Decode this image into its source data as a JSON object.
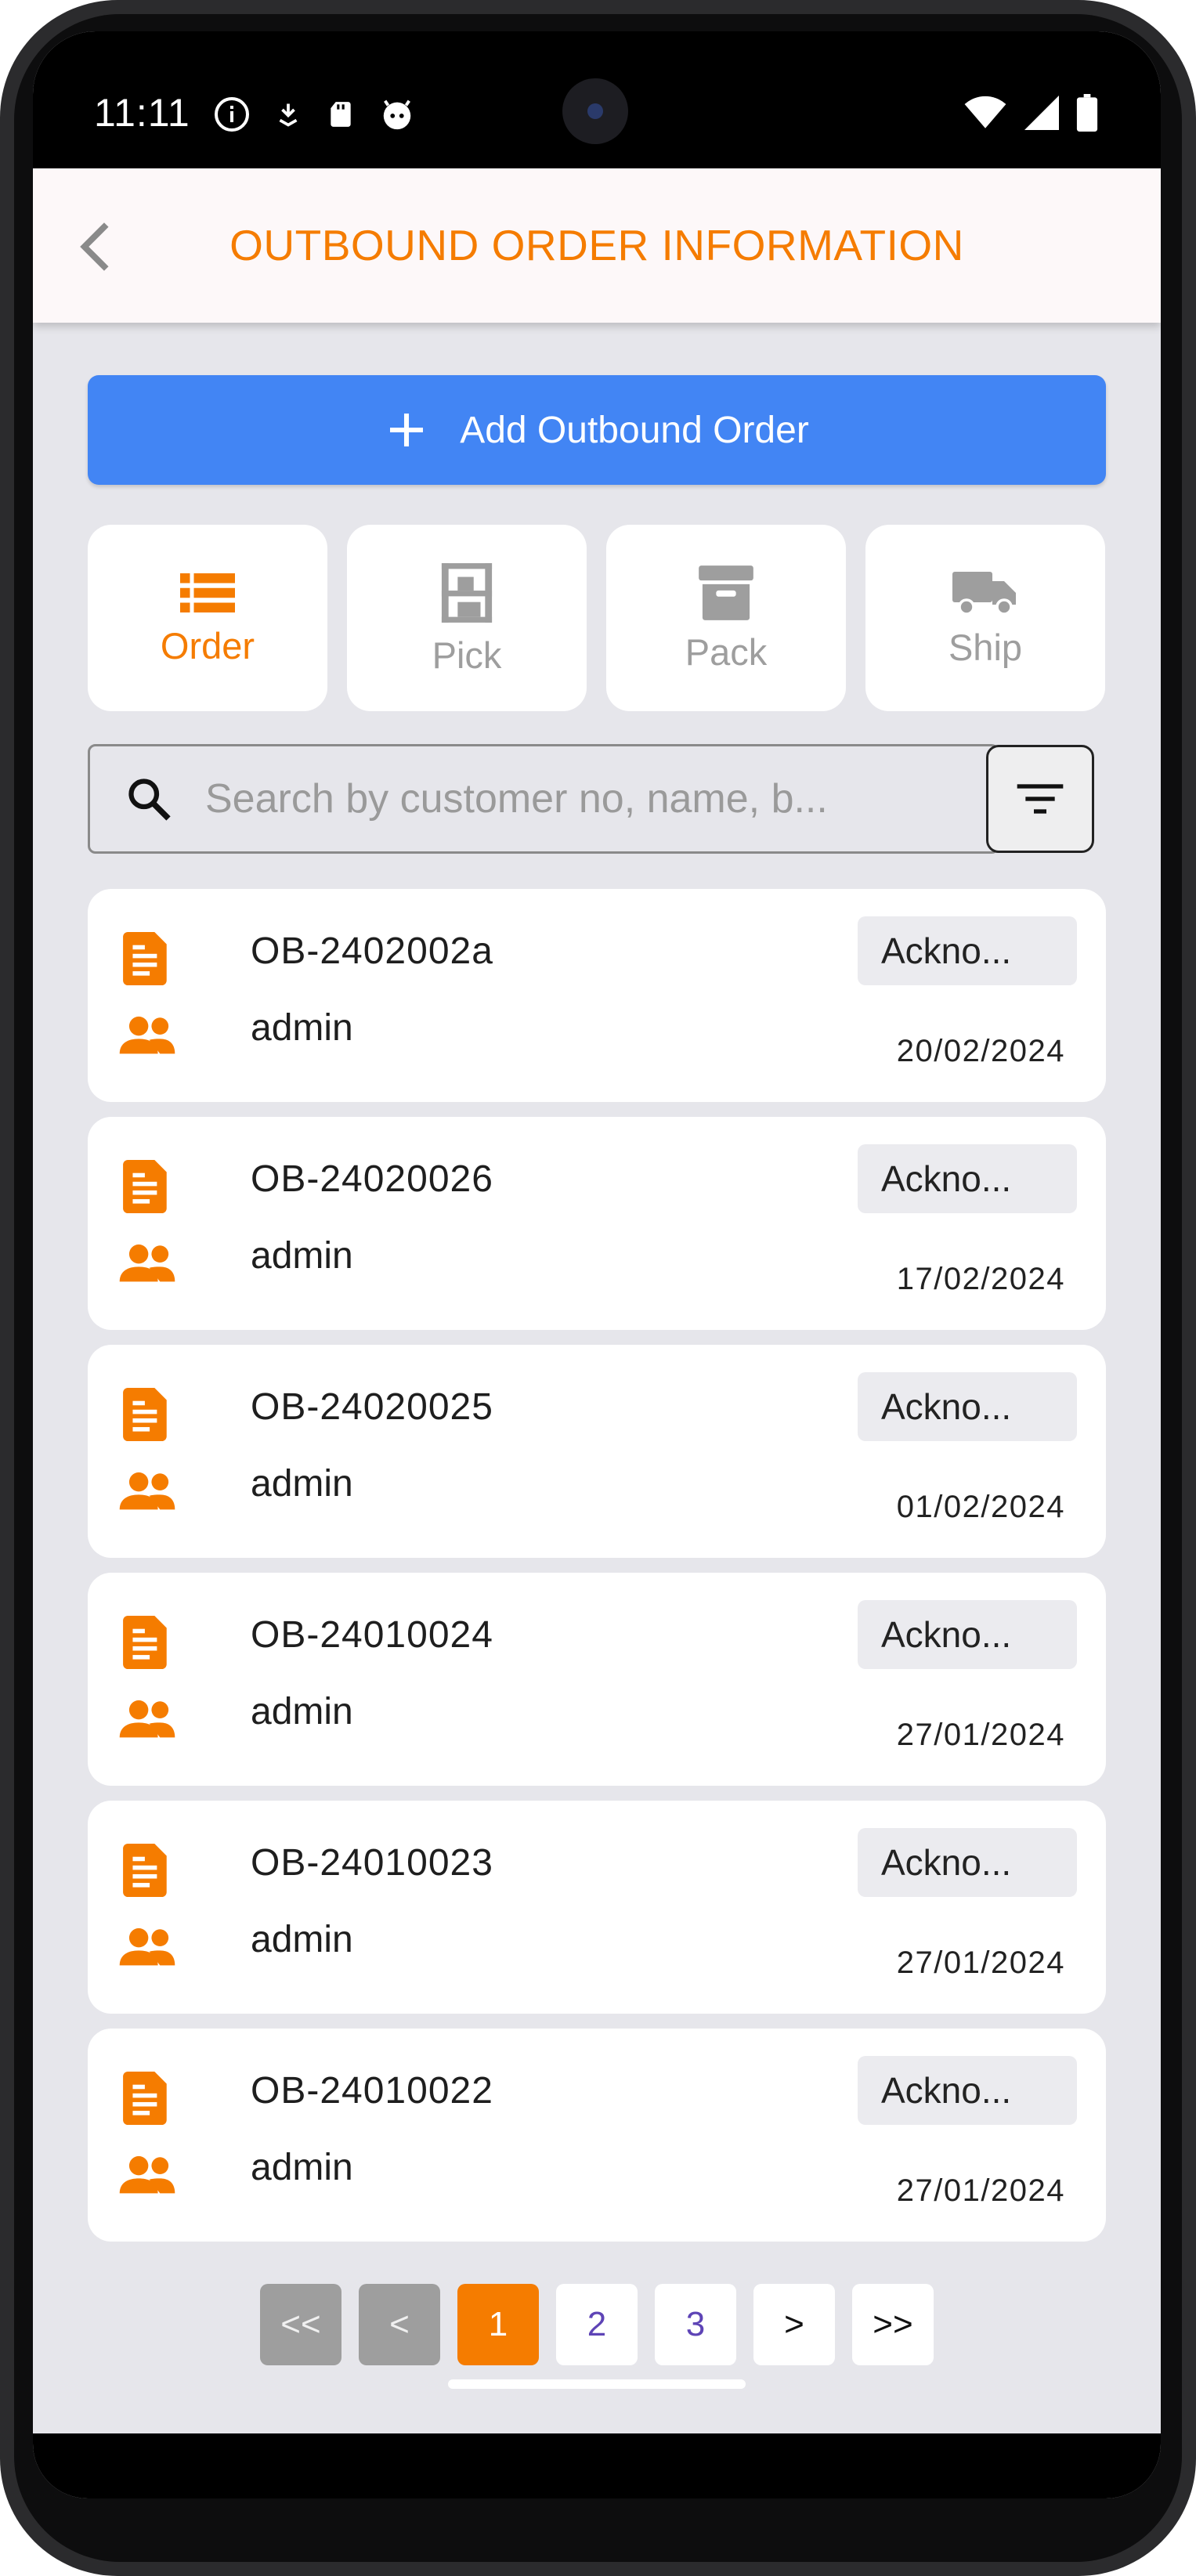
{
  "status_bar": {
    "time": "11:11"
  },
  "app_bar": {
    "title": "OUTBOUND ORDER INFORMATION"
  },
  "add_button": {
    "label": "Add Outbound Order"
  },
  "tabs": [
    {
      "label": "Order",
      "icon": "list-icon",
      "active": true
    },
    {
      "label": "Pick",
      "icon": "shelf-icon",
      "active": false
    },
    {
      "label": "Pack",
      "icon": "archive-box-icon",
      "active": false
    },
    {
      "label": "Ship",
      "icon": "truck-icon",
      "active": false
    }
  ],
  "search": {
    "placeholder": "Search by customer no, name, b...",
    "value": ""
  },
  "orders": [
    {
      "order_no": "OB-2402002a",
      "user": "admin",
      "status": "Ackno...",
      "date": "20/02/2024"
    },
    {
      "order_no": "OB-24020026",
      "user": "admin",
      "status": "Ackno...",
      "date": "17/02/2024"
    },
    {
      "order_no": "OB-24020025",
      "user": "admin",
      "status": "Ackno...",
      "date": "01/02/2024"
    },
    {
      "order_no": "OB-24010024",
      "user": "admin",
      "status": "Ackno...",
      "date": "27/01/2024"
    },
    {
      "order_no": "OB-24010023",
      "user": "admin",
      "status": "Ackno...",
      "date": "27/01/2024"
    },
    {
      "order_no": "OB-24010022",
      "user": "admin",
      "status": "Ackno...",
      "date": "27/01/2024"
    }
  ],
  "pagination": {
    "first": "<<",
    "prev": "<",
    "pages": [
      "1",
      "2",
      "3"
    ],
    "current_page": "1",
    "next": ">",
    "last": ">>"
  },
  "colors": {
    "accent": "#f57c00",
    "primary_button": "#4285f4",
    "background": "#e6e6eb"
  }
}
